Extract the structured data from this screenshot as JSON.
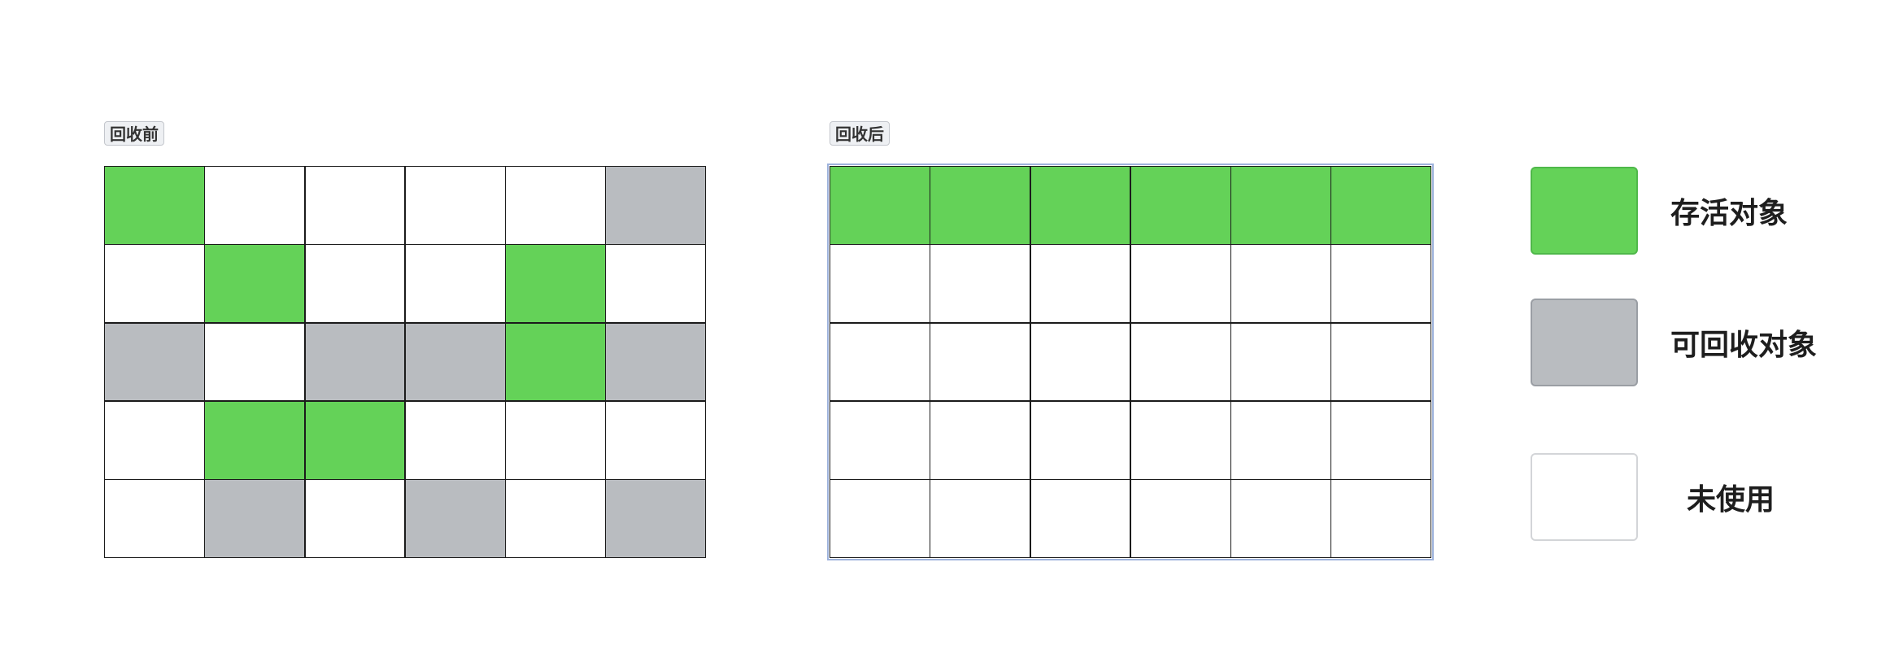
{
  "colors": {
    "alive": "#64d258",
    "recyclable": "#b9bcc0",
    "unused": "#ffffff"
  },
  "before": {
    "label": "回收前",
    "rows": [
      [
        "alive",
        "unused",
        "unused",
        "unused",
        "unused",
        "recyclable"
      ],
      [
        "unused",
        "alive",
        "unused",
        "unused",
        "alive",
        "unused"
      ],
      [
        "recyclable",
        "unused",
        "recyclable",
        "recyclable",
        "alive",
        "recyclable"
      ],
      [
        "unused",
        "alive",
        "alive",
        "unused",
        "unused",
        "unused"
      ],
      [
        "unused",
        "recyclable",
        "unused",
        "recyclable",
        "unused",
        "recyclable"
      ]
    ]
  },
  "after": {
    "label": "回收后",
    "rows": [
      [
        "alive",
        "alive",
        "alive",
        "alive",
        "alive",
        "alive"
      ],
      [
        "unused",
        "unused",
        "unused",
        "unused",
        "unused",
        "unused"
      ],
      [
        "unused",
        "unused",
        "unused",
        "unused",
        "unused",
        "unused"
      ],
      [
        "unused",
        "unused",
        "unused",
        "unused",
        "unused",
        "unused"
      ],
      [
        "unused",
        "unused",
        "unused",
        "unused",
        "unused",
        "unused"
      ]
    ]
  },
  "legend": [
    {
      "state": "alive",
      "label": "存活对象"
    },
    {
      "state": "recyclable",
      "label": "可回收对象"
    },
    {
      "state": "unused",
      "label": "未使用"
    }
  ]
}
